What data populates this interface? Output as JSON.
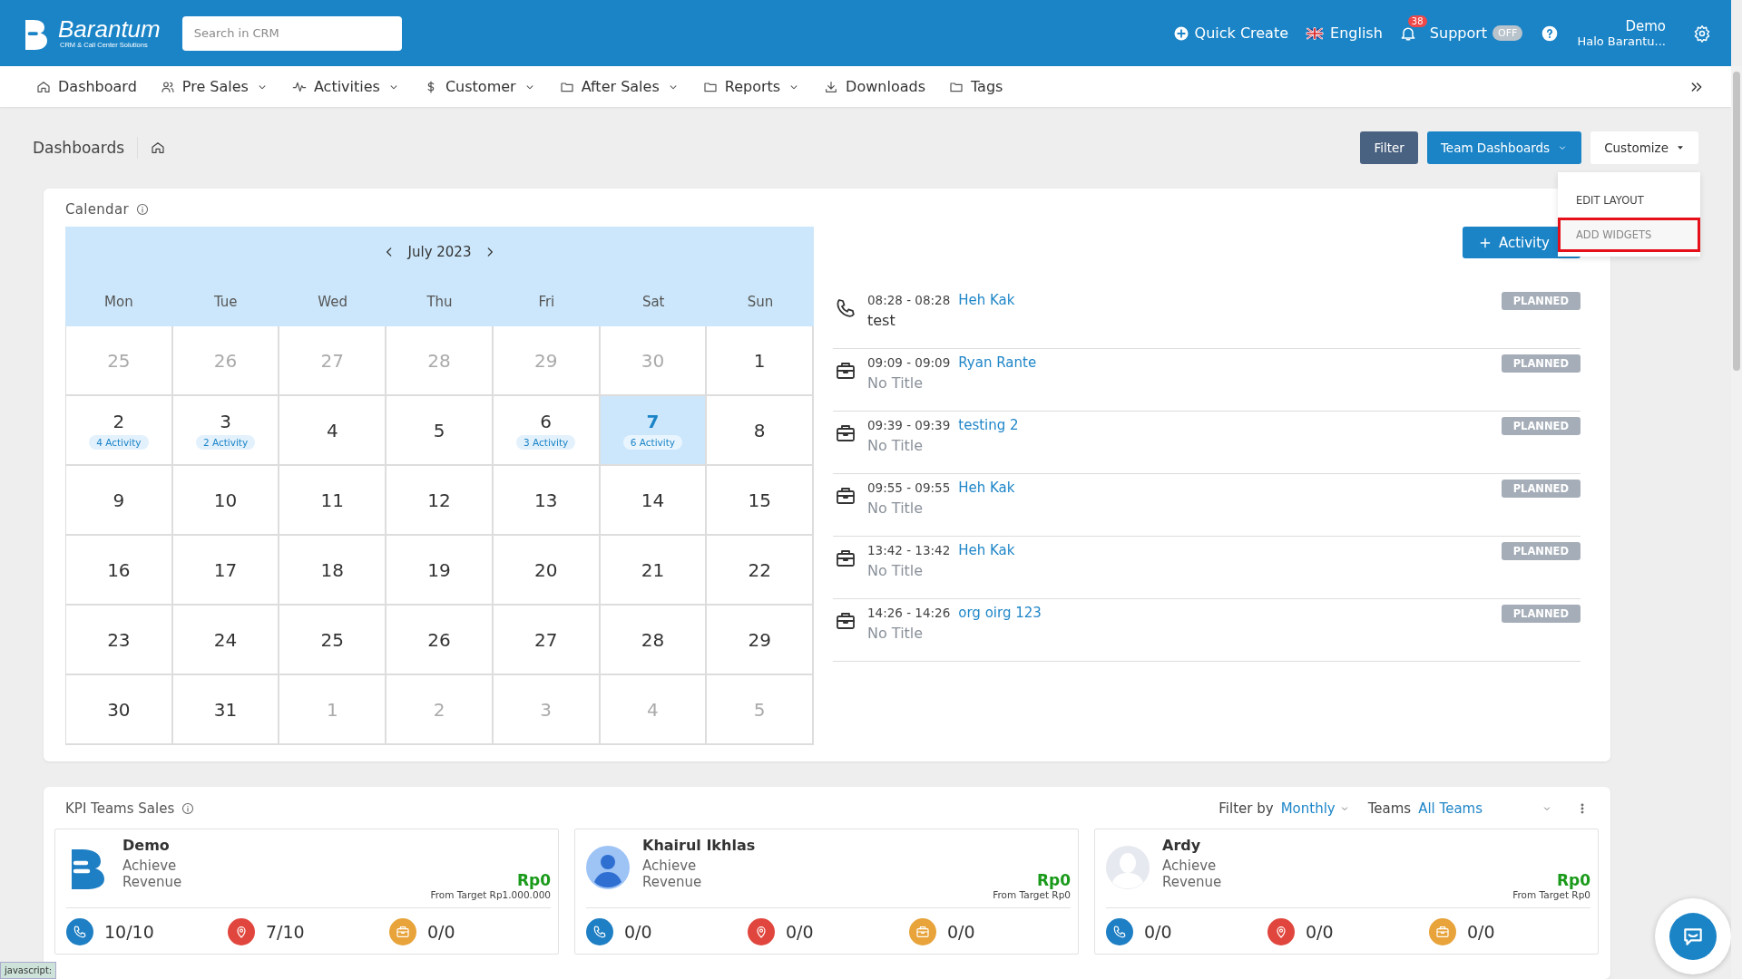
{
  "topbar": {
    "logo_name": "Barantum",
    "logo_tagline": "CRM & Call Center Solutions",
    "search": {
      "placeholder": "Search in CRM"
    },
    "quick_create": "Quick Create",
    "language": "English",
    "notification_count": "38",
    "support": "Support",
    "support_toggle": {
      "label": "OFF",
      "on": false
    },
    "user_name": "Demo",
    "user_org": "Halo Barantu..."
  },
  "nav": [
    {
      "label": "Dashboard",
      "dropdown": false
    },
    {
      "label": "Pre Sales",
      "dropdown": true
    },
    {
      "label": "Activities",
      "dropdown": true
    },
    {
      "label": "Customer",
      "dropdown": true
    },
    {
      "label": "After Sales",
      "dropdown": true
    },
    {
      "label": "Reports",
      "dropdown": true
    },
    {
      "label": "Downloads",
      "dropdown": false
    },
    {
      "label": "Tags",
      "dropdown": false
    }
  ],
  "page_title": "Dashboards",
  "buttons": [
    {
      "label": "Filter",
      "kind": "dark"
    },
    {
      "label": "Team Dashboards",
      "kind": "primary"
    },
    {
      "label": "Customize",
      "kind": "plain"
    }
  ],
  "customize_menu": [
    {
      "label": "EDIT LAYOUT",
      "selected": false
    },
    {
      "label": "ADD WIDGETS",
      "selected": true
    }
  ],
  "calendar": {
    "title": "Calendar",
    "month": "July 2023",
    "weekdays": [
      "Mon",
      "Tue",
      "Wed",
      "Thu",
      "Fri",
      "Sat",
      "Sun"
    ],
    "weeks": [
      [
        {
          "day": "25",
          "muted": true
        },
        {
          "day": "26",
          "muted": true
        },
        {
          "day": "27",
          "muted": true
        },
        {
          "day": "28",
          "muted": true
        },
        {
          "day": "29",
          "muted": true
        },
        {
          "day": "30",
          "muted": true
        },
        {
          "day": "1",
          "muted": false
        }
      ],
      [
        {
          "day": "2",
          "muted": false,
          "activity": "4 Activity"
        },
        {
          "day": "3",
          "muted": false,
          "activity": "2 Activity"
        },
        {
          "day": "4",
          "muted": false
        },
        {
          "day": "5",
          "muted": false
        },
        {
          "day": "6",
          "muted": false,
          "activity": "3 Activity"
        },
        {
          "day": "7",
          "muted": false,
          "activity": "6 Activity",
          "selected": true
        },
        {
          "day": "8",
          "muted": false
        }
      ],
      [
        {
          "day": "9",
          "muted": false
        },
        {
          "day": "10",
          "muted": false
        },
        {
          "day": "11",
          "muted": false
        },
        {
          "day": "12",
          "muted": false
        },
        {
          "day": "13",
          "muted": false
        },
        {
          "day": "14",
          "muted": false
        },
        {
          "day": "15",
          "muted": false
        }
      ],
      [
        {
          "day": "16",
          "muted": false
        },
        {
          "day": "17",
          "muted": false
        },
        {
          "day": "18",
          "muted": false
        },
        {
          "day": "19",
          "muted": false
        },
        {
          "day": "20",
          "muted": false
        },
        {
          "day": "21",
          "muted": false
        },
        {
          "day": "22",
          "muted": false
        }
      ],
      [
        {
          "day": "23",
          "muted": false
        },
        {
          "day": "24",
          "muted": false
        },
        {
          "day": "25",
          "muted": false
        },
        {
          "day": "26",
          "muted": false
        },
        {
          "day": "27",
          "muted": false
        },
        {
          "day": "28",
          "muted": false
        },
        {
          "day": "29",
          "muted": false
        }
      ],
      [
        {
          "day": "30",
          "muted": false
        },
        {
          "day": "31",
          "muted": false
        },
        {
          "day": "1",
          "muted": true
        },
        {
          "day": "2",
          "muted": true
        },
        {
          "day": "3",
          "muted": true
        },
        {
          "day": "4",
          "muted": true
        },
        {
          "day": "5",
          "muted": true
        }
      ]
    ],
    "add_button": "Activity",
    "activities": [
      {
        "kind": "call",
        "time": "08:28 - 08:28",
        "contact": "Heh Kak",
        "title": "test",
        "untitled": false,
        "status": "PLANNED"
      },
      {
        "kind": "meeting",
        "time": "09:09 - 09:09",
        "contact": "Ryan Rante",
        "title": "No Title",
        "untitled": true,
        "status": "PLANNED"
      },
      {
        "kind": "meeting",
        "time": "09:39 - 09:39",
        "contact": "testing 2",
        "title": "No Title",
        "untitled": true,
        "status": "PLANNED"
      },
      {
        "kind": "meeting",
        "time": "09:55 - 09:55",
        "contact": "Heh Kak",
        "title": "No Title",
        "untitled": true,
        "status": "PLANNED"
      },
      {
        "kind": "meeting",
        "time": "13:42 - 13:42",
        "contact": "Heh Kak",
        "title": "No Title",
        "untitled": true,
        "status": "PLANNED"
      },
      {
        "kind": "meeting",
        "time": "14:26 - 14:26",
        "contact": "org oirg 123",
        "title": "No Title",
        "untitled": true,
        "status": "PLANNED"
      }
    ]
  },
  "kpi": {
    "title": "KPI Teams Sales",
    "filter_label": "Filter by",
    "filter_value": "Monthly",
    "teams_label": "Teams",
    "teams_value": "All Teams",
    "cards": [
      {
        "name": "Demo",
        "kind": "logo",
        "achieve": "Achieve",
        "revenue": "Revenue",
        "amount": "Rp0",
        "target": "From Target Rp1.000.000",
        "stats": [
          {
            "kind": "call",
            "value": "10/10",
            "color": "#1f7fc4"
          },
          {
            "kind": "visit",
            "value": "7/10",
            "color": "#e0463d"
          },
          {
            "kind": "meeting",
            "value": "0/0",
            "color": "#e8a33a"
          }
        ]
      },
      {
        "name": "Khairul Ikhlas",
        "kind": "person",
        "achieve": "Achieve",
        "revenue": "Revenue",
        "amount": "Rp0",
        "target": "From Target Rp0",
        "stats": [
          {
            "kind": "call",
            "value": "0/0",
            "color": "#1f7fc4"
          },
          {
            "kind": "visit",
            "value": "0/0",
            "color": "#e0463d"
          },
          {
            "kind": "meeting",
            "value": "0/0",
            "color": "#e8a33a"
          }
        ]
      },
      {
        "name": "Ardy",
        "kind": "silhouette",
        "achieve": "Achieve",
        "revenue": "Revenue",
        "amount": "Rp0",
        "target": "From Target Rp0",
        "stats": [
          {
            "kind": "call",
            "value": "0/0",
            "color": "#1f7fc4"
          },
          {
            "kind": "visit",
            "value": "0/0",
            "color": "#e0463d"
          },
          {
            "kind": "meeting",
            "value": "0/0",
            "color": "#e8a33a"
          }
        ]
      }
    ]
  },
  "status_text": "javascript:"
}
